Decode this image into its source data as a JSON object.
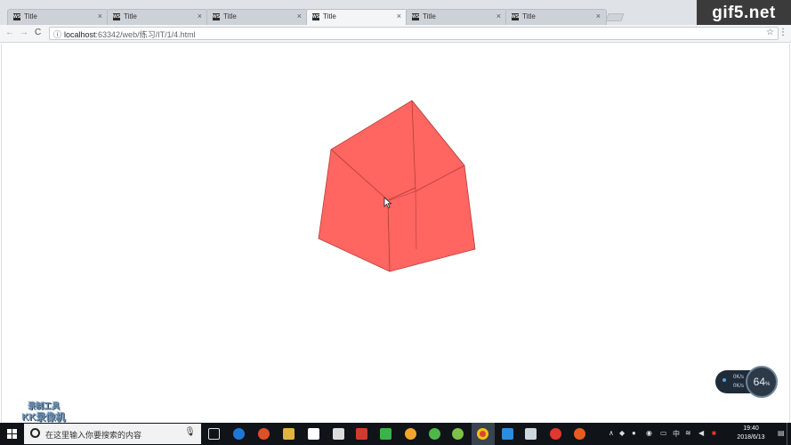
{
  "watermark": "gif5.net",
  "tabs": [
    {
      "title": "Title",
      "favicon": "WS",
      "active": false
    },
    {
      "title": "Title",
      "favicon": "WS",
      "active": false
    },
    {
      "title": "Title",
      "favicon": "WS",
      "active": false
    },
    {
      "title": "Title",
      "favicon": "WS",
      "active": true
    },
    {
      "title": "Title",
      "favicon": "WS",
      "active": false
    },
    {
      "title": "Title",
      "favicon": "WS",
      "active": false
    }
  ],
  "tab_close": "×",
  "toolbar": {
    "back_icon": "←",
    "forward_icon": "→",
    "reload_icon": "C",
    "url_host": "localhost",
    "url_rest": ":63342/web/练习/IT/1/4.html",
    "bookmark_icon": "☆",
    "menu_icon": "⋮"
  },
  "page": {
    "cube_color": "#ff6561",
    "cube_edge_color": "#b3403c"
  },
  "recorder_stamp": {
    "line1": "录制工具",
    "line2": "KK录像机"
  },
  "netspeed": {
    "up": "0K/s",
    "down": "0K/s",
    "percent": "64",
    "percent_unit": "%"
  },
  "taskbar": {
    "search_placeholder": "在这里输入你要搜索的内容",
    "mic_icon": "🎙",
    "clock_time": "19:40",
    "clock_date": "2018/6/13",
    "ime": "中"
  }
}
